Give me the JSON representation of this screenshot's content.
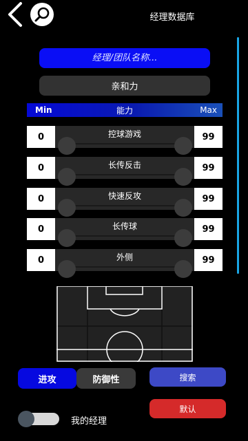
{
  "header": {
    "back_icon": "chevron-left-icon",
    "search_icon": "magnifier-icon",
    "title": "经理数据库"
  },
  "search": {
    "placeholder": "经理/团队名称..."
  },
  "trait_select": {
    "value": "亲和力"
  },
  "ability_header": {
    "min_label": "Min",
    "title": "能力",
    "max_label": "Max"
  },
  "filters": [
    {
      "label": "控球游戏",
      "min": "0",
      "max": "99"
    },
    {
      "label": "长传反击",
      "min": "0",
      "max": "99"
    },
    {
      "label": "快速反攻",
      "min": "0",
      "max": "99"
    },
    {
      "label": "长传球",
      "min": "0",
      "max": "99"
    },
    {
      "label": "外侧",
      "min": "0",
      "max": "99"
    }
  ],
  "tabs": {
    "attack": "进攻",
    "defense": "防御性"
  },
  "actions": {
    "search": "搜索",
    "default": "默认"
  },
  "toggle": {
    "label": "我的经理",
    "on": false
  },
  "colors": {
    "accent_blue": "#0a0ef5",
    "search_button": "#3d49c6",
    "default_button": "#d52a2a",
    "scroll_indicator": "#19a6e6"
  }
}
